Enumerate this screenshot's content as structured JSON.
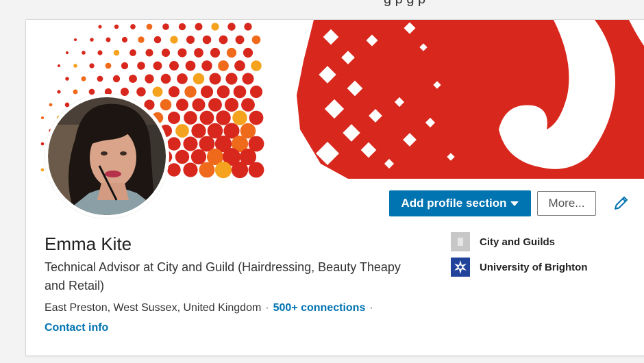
{
  "page_header": {
    "clipped_text": "g        p            g               p"
  },
  "profile": {
    "name": "Emma Kite",
    "headline": "Technical Advisor at City and Guild (Hairdressing, Beauty Theapy and Retail)",
    "location": "East Preston, West Sussex, United Kingdom",
    "separator": "·",
    "connections": "500+ connections",
    "contact_info": "Contact info"
  },
  "actions": {
    "add_section_label": "Add profile section",
    "more_label": "More...",
    "edit_icon": "pencil-icon"
  },
  "education": [
    {
      "name": "City and Guilds",
      "logo": "building-placeholder-icon"
    },
    {
      "name": "University of Brighton",
      "logo": "university-crest-icon"
    }
  ],
  "colors": {
    "banner_red": "#d8281d",
    "banner_orange": "#f06a1c",
    "banner_yellow": "#f5a21f",
    "primary_button": "#0073b1",
    "link": "#0073b1"
  }
}
